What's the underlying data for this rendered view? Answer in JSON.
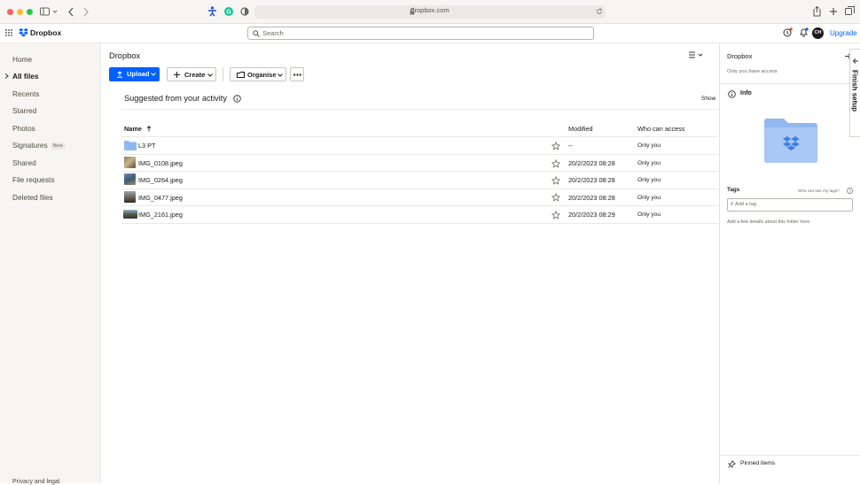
{
  "browser": {
    "url": "dropbox.com"
  },
  "header": {
    "brand": "Dropbox",
    "search_placeholder": "Search",
    "avatar_initials": "CH",
    "upgrade_label": "Upgrade"
  },
  "sidebar": {
    "items": [
      {
        "label": "Home"
      },
      {
        "label": "All files"
      },
      {
        "label": "Recents"
      },
      {
        "label": "Starred"
      },
      {
        "label": "Photos"
      },
      {
        "label": "Signatures",
        "badge": "New"
      },
      {
        "label": "Shared"
      },
      {
        "label": "File requests"
      },
      {
        "label": "Deleted files"
      }
    ],
    "footer": "Privacy and legal"
  },
  "main": {
    "breadcrumb": "Dropbox",
    "toolbar": {
      "upload_label": "Upload",
      "create_label": "Create",
      "organise_label": "Organise"
    },
    "suggested_title": "Suggested from your activity",
    "show_label": "Show",
    "columns": {
      "name": "Name",
      "modified": "Modified",
      "access": "Who can access"
    },
    "rows": [
      {
        "name": "L3 PT",
        "modified": "--",
        "access": "Only you"
      },
      {
        "name": "IMG_0108.jpeg",
        "modified": "20/2/2023 08:28",
        "access": "Only you"
      },
      {
        "name": "IMG_0264.jpeg",
        "modified": "20/2/2023 08:28",
        "access": "Only you"
      },
      {
        "name": "IMG_0477.jpeg",
        "modified": "20/2/2023 08:28",
        "access": "Only you"
      },
      {
        "name": "IMG_2161.jpeg",
        "modified": "20/2/2023 08:29",
        "access": "Only you"
      }
    ]
  },
  "details": {
    "title": "Dropbox",
    "subtitle": "Only you have access",
    "info_label": "Info",
    "tags_label": "Tags",
    "tags_help": "Who can see my tags?",
    "tag_placeholder": "Add a tag",
    "details_hint": "Add a few details about this folder here.",
    "pinned_label": "Pinned items",
    "finish_setup": "Finish setup"
  },
  "colors": {
    "accent": "#0061fe",
    "folder": "#90b8ef",
    "sidebar_bg": "#f7f5f2"
  }
}
